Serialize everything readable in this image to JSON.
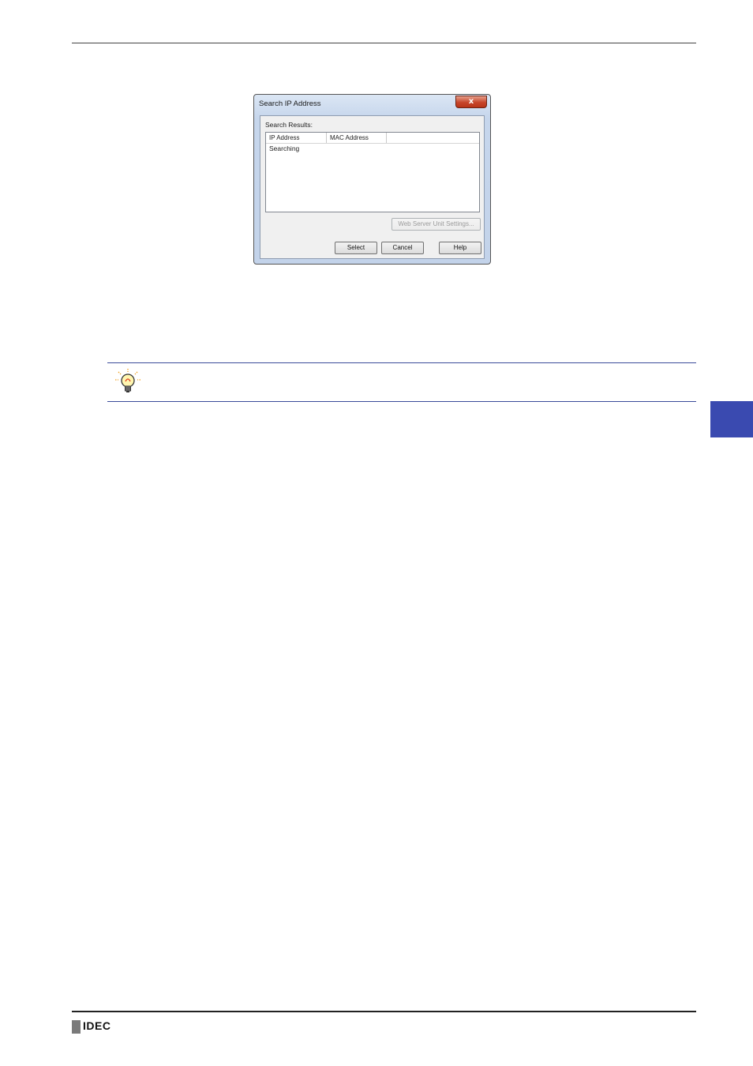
{
  "dialog": {
    "title": "Search IP Address",
    "close_label": "x",
    "results_label": "Search Results:",
    "columns": [
      "IP Address",
      "MAC Address"
    ],
    "rows": [
      "Searching"
    ],
    "web_server_button": "Web Server Unit Settings...",
    "select_button": "Select",
    "cancel_button": "Cancel",
    "help_button": "Help"
  },
  "footer": {
    "logo_text": "IDEC"
  },
  "colors": {
    "accent": "#3a4ab0",
    "hint_rule": "#3a4a9a"
  },
  "icons": {
    "hint": "lightbulb-icon"
  }
}
